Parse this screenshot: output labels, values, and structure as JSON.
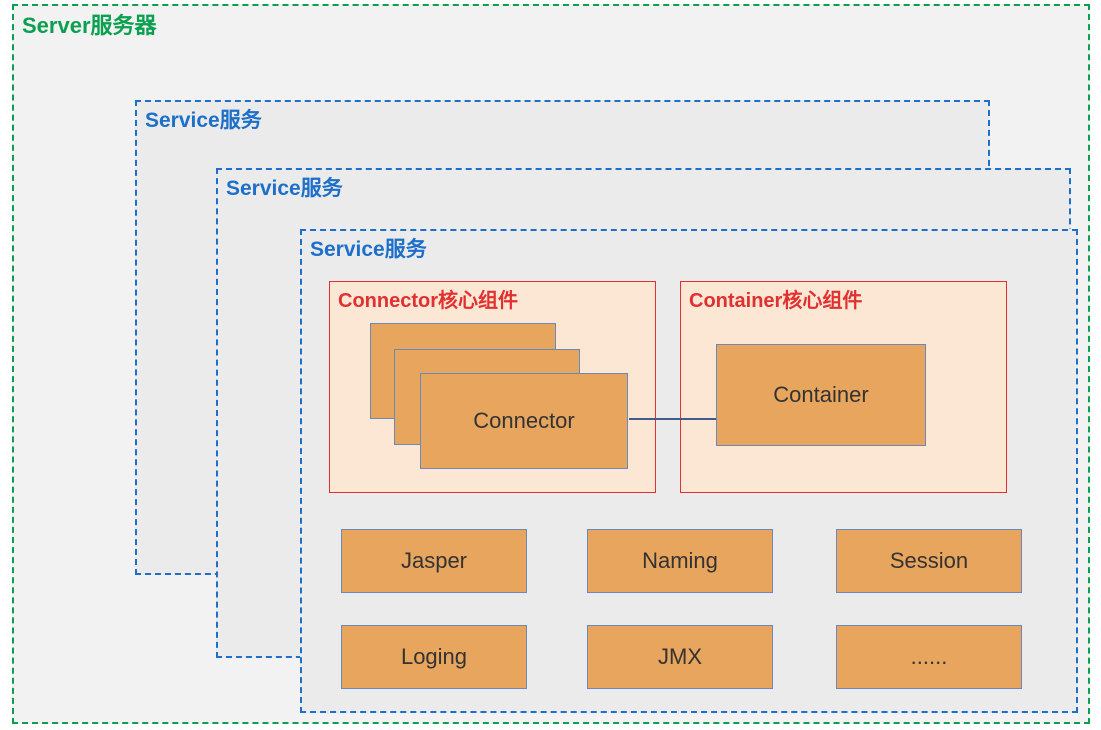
{
  "server": {
    "label": "Server服务器"
  },
  "services": {
    "s1": "Service服务",
    "s2": "Service服务",
    "s3": "Service服务"
  },
  "core": {
    "connector_label": "Connector核心组件",
    "container_label": "Container核心组件",
    "connector_text": "Connector",
    "container_text": "Container"
  },
  "modules": {
    "jasper": "Jasper",
    "naming": "Naming",
    "session": "Session",
    "loging": "Loging",
    "jmx": "JMX",
    "ellipsis": "......"
  }
}
